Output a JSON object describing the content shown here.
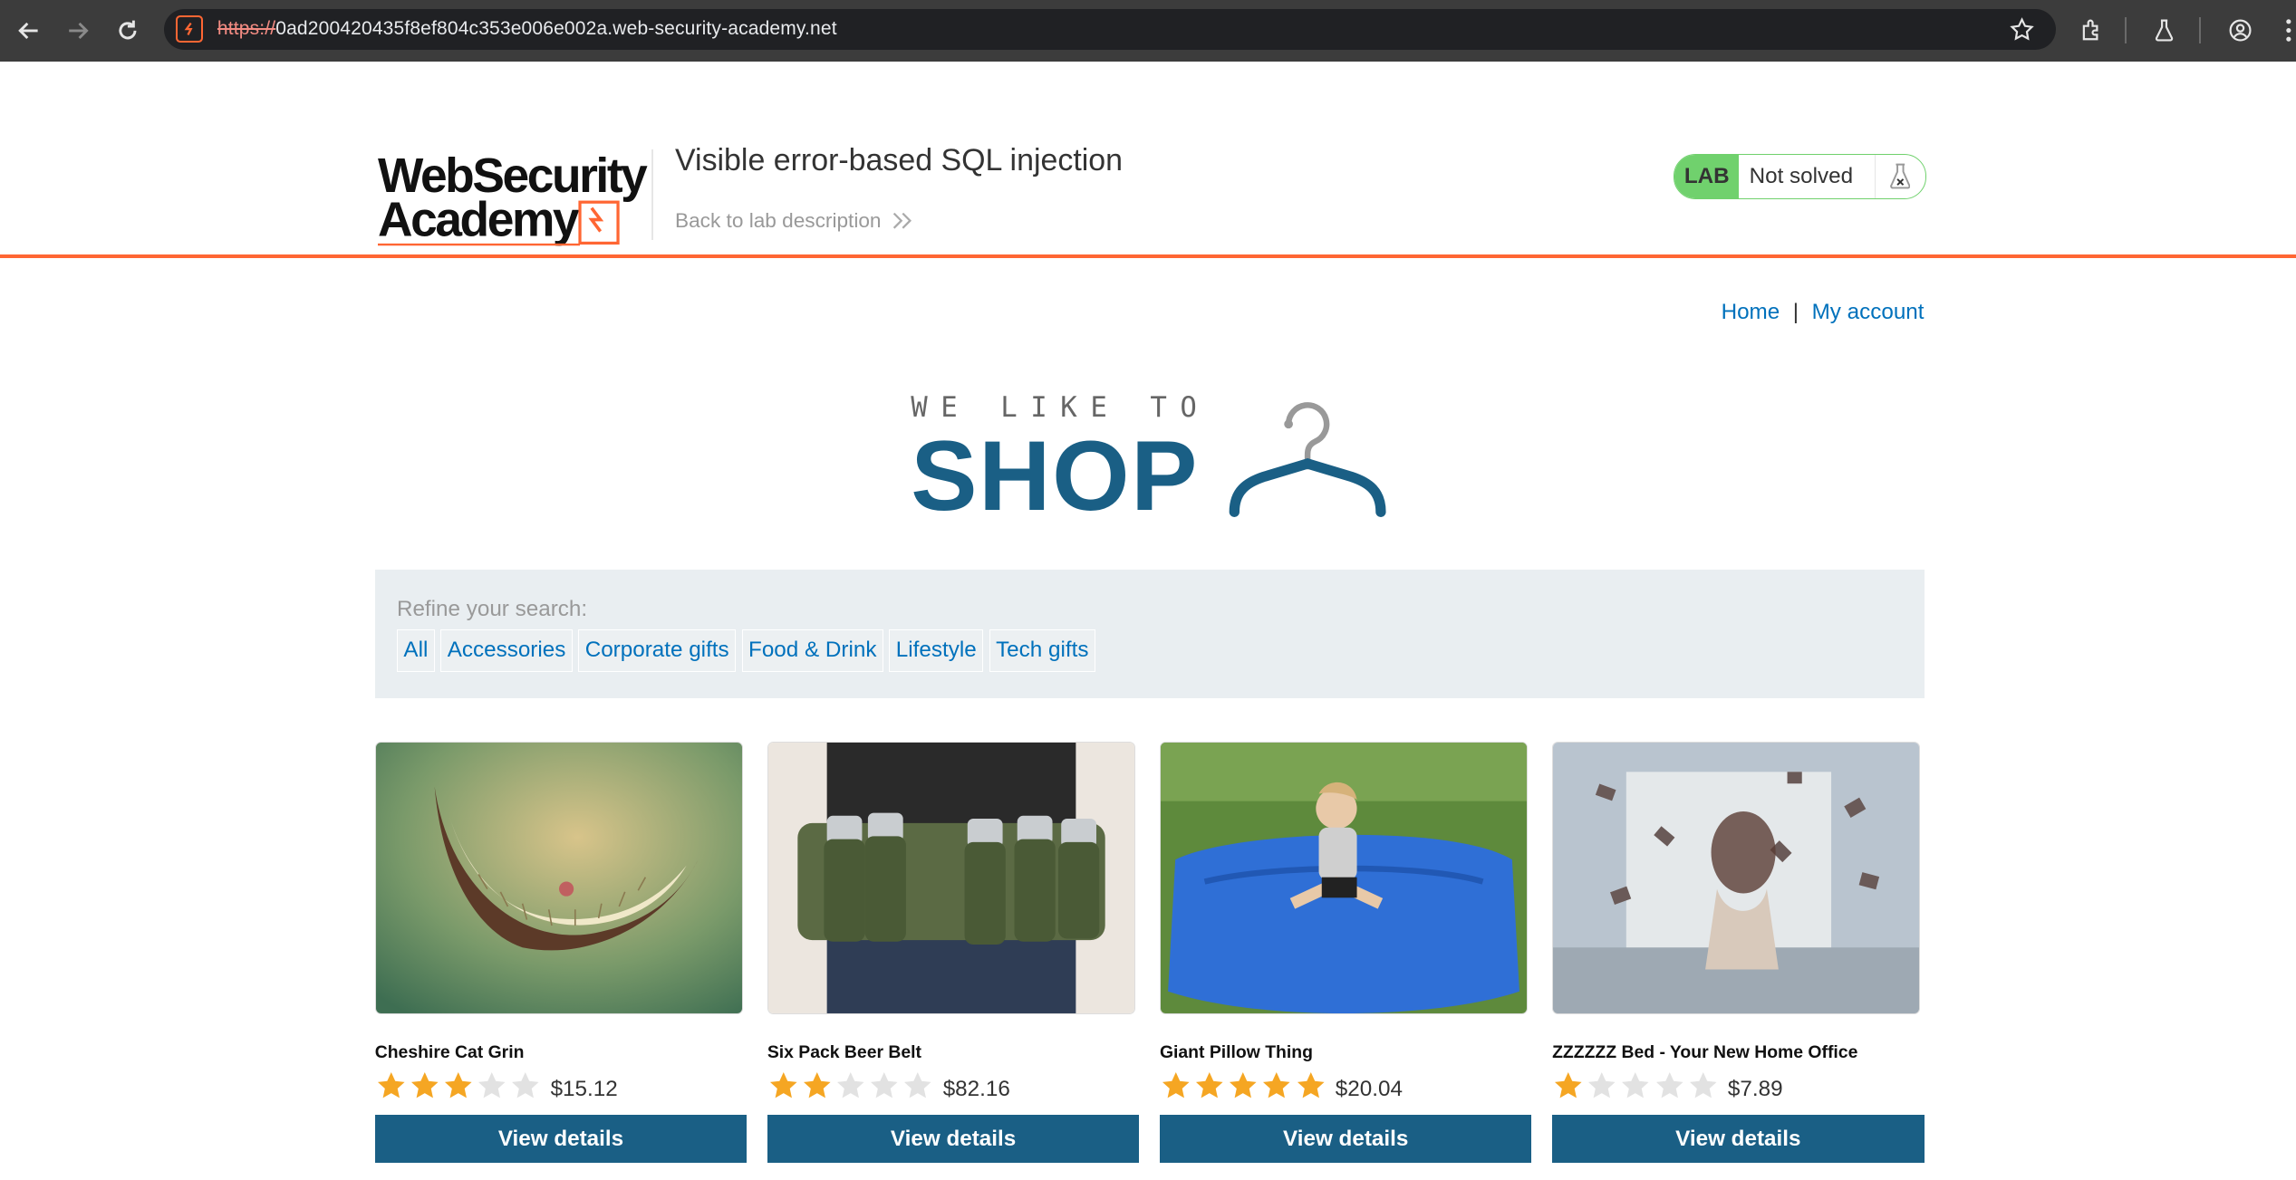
{
  "browser": {
    "url_scheme": "https://",
    "url_rest": "0ad200420435f8ef804c353e006e002a.web-security-academy.net",
    "icons": [
      "back-icon",
      "forward-icon",
      "reload-icon",
      "site-icon",
      "bookmark-star-icon",
      "extensions-icon",
      "labs-icon",
      "profile-icon",
      "menu-icon"
    ]
  },
  "lab": {
    "logo_line1": "WebSecurity",
    "logo_line2": "Academy",
    "title": "Visible error-based SQL injection",
    "back_link": "Back to lab description",
    "badge": "LAB",
    "status": "Not solved",
    "accent": "#ff6633",
    "badge_color": "#70d16d"
  },
  "nav": {
    "home": "Home",
    "separator": "|",
    "account": "My account"
  },
  "hero": {
    "tagline": "WE LIKE TO",
    "shop": "SHOP"
  },
  "filters": {
    "label": "Refine your search:",
    "categories": [
      "All",
      "Accessories",
      "Corporate gifts",
      "Food & Drink",
      "Lifestyle",
      "Tech gifts"
    ]
  },
  "products": [
    {
      "name": "Cheshire Cat Grin",
      "rating": 3,
      "price": "$15.12",
      "button": "View details"
    },
    {
      "name": "Six Pack Beer Belt",
      "rating": 2,
      "price": "$82.16",
      "button": "View details"
    },
    {
      "name": "Giant Pillow Thing",
      "rating": 5,
      "price": "$20.04",
      "button": "View details"
    },
    {
      "name": "ZZZZZZ Bed - Your New Home Office",
      "rating": 1,
      "price": "$7.89",
      "button": "View details"
    }
  ],
  "colors": {
    "primary": "#1a5f85",
    "link": "#0071bc",
    "star_on": "#f5a623",
    "star_off": "#e2e2e2"
  }
}
